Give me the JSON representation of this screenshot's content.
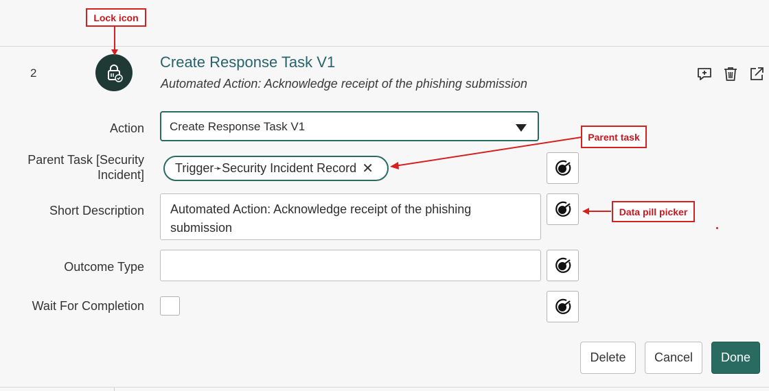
{
  "step": {
    "number": "2",
    "title": "Create Response Task V1",
    "subtitle": "Automated Action: Acknowledge receipt of the phishing submission",
    "icon": "lock-icon"
  },
  "header_actions": [
    {
      "name": "add-comment-icon"
    },
    {
      "name": "trash-icon"
    },
    {
      "name": "open-external-icon"
    }
  ],
  "form": {
    "action": {
      "label": "Action",
      "value": "Create Response Task V1"
    },
    "parent_task": {
      "label_line1": "Parent Task [Security",
      "label_line2": "Incident]",
      "pill_source": "Trigger",
      "pill_separator": "➛",
      "pill_target": "Security Incident Record",
      "remove_glyph": "✕"
    },
    "short_description": {
      "label": "Short Description",
      "value": "Automated Action: Acknowledge receipt of the phishing submission"
    },
    "outcome_type": {
      "label": "Outcome Type",
      "value": ""
    },
    "wait_for_completion": {
      "label": "Wait For Completion",
      "checked": false
    }
  },
  "buttons": {
    "delete": "Delete",
    "cancel": "Cancel",
    "done": "Done"
  },
  "annotations": {
    "lock": "Lock icon",
    "parent_task": "Parent task",
    "data_pill_picker": "Data pill picker"
  },
  "colors": {
    "accent": "#2a6b61",
    "title": "#27636b",
    "annotation_red": "#d61f1f",
    "icon_circle": "#1f3a35"
  }
}
